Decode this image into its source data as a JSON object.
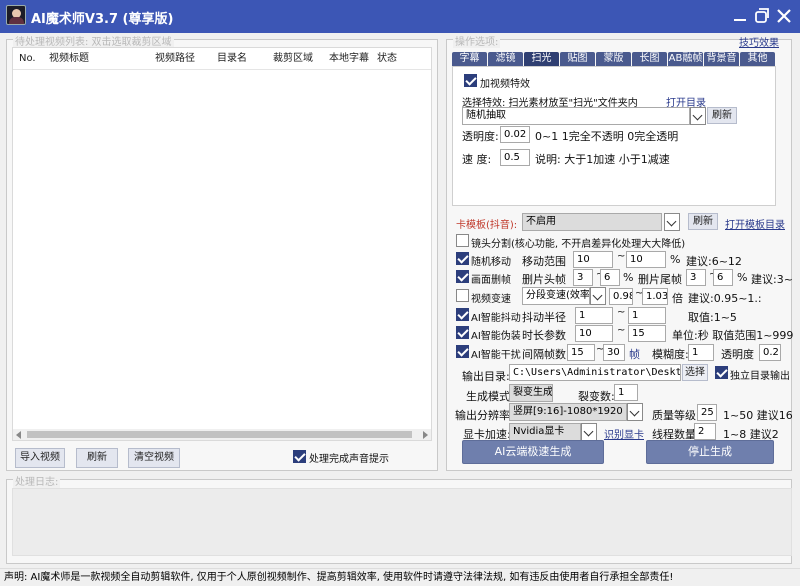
{
  "app": {
    "title": "AI魔术师V3.7 (尊享版)"
  },
  "left_panel": {
    "legend": "待处理视频列表: 双击选取裁剪区域",
    "columns": [
      "No.",
      "视频标题",
      "视频路径",
      "目录名",
      "裁剪区域",
      "本地字幕",
      "状态"
    ],
    "buttons": {
      "import": "导入视频",
      "refresh": "刷新",
      "clear": "清空视频"
    },
    "sound_prompt": {
      "label": "处理完成声音提示",
      "checked": true
    }
  },
  "options": {
    "legend": "操作选项:",
    "tutorial_link": "技巧效果",
    "tabs": [
      "字幕",
      "滤镜",
      "扫光",
      "贴图",
      "蒙版",
      "长图",
      "AB融帧",
      "背景音",
      "其他"
    ],
    "active_tab": "扫光",
    "scan": {
      "add_effect": {
        "label": "加视频特效",
        "checked": true
      },
      "hint": "选择特效: 扫光素材放至\"扫光\"文件夹内",
      "open_dir": "打开目录",
      "effect_select": "随机抽取",
      "refresh": "刷新",
      "opacity_label": "透明度:",
      "opacity_value": "0.02",
      "opacity_note": "0~1   1完全不透明 0完全透明",
      "speed_label": "速   度:",
      "speed_value": "0.5",
      "speed_note": "说明: 大于1加速 小于1减速"
    },
    "card_template": {
      "label": "卡模板(抖音):",
      "value": "不启用",
      "refresh": "刷新",
      "open_dir": "打开模板目录"
    },
    "scene_split": {
      "label": "镜头分割(核心功能, 不开启差异化处理大大降低)",
      "checked": false
    },
    "random_move": {
      "label": "随机移动",
      "checked": true,
      "range_label": "移动范围",
      "min": "10",
      "max": "10",
      "unit": "%",
      "suggest": "建议:6~12"
    },
    "frame_cut": {
      "label": "画面删帧",
      "checked": true,
      "head_label": "删片头帧",
      "head_min": "3",
      "head_max": "6",
      "unit": "%",
      "tail_label": "删片尾帧",
      "tail_min": "3",
      "tail_max": "6",
      "tail_unit": "%",
      "suggest": "建议:3~"
    },
    "speed_change": {
      "label": "视频变速",
      "checked": false,
      "mode": "分段变速(效率",
      "min": "0.98",
      "max": "1.03",
      "unit": "倍",
      "suggest": "建议:0.95~1.:"
    },
    "ai_shake": {
      "label": "AI智能抖动",
      "checked": true,
      "radius_label": "抖动半径",
      "min": "1",
      "max": "1",
      "note": "取值:1~5"
    },
    "ai_disguise": {
      "label": "AI智能伪装",
      "checked": true,
      "param_label": "时长参数",
      "min": "10",
      "max": "15",
      "note": "单位:秒 取值范围1~999"
    },
    "ai_interfere": {
      "label": "AI智能干扰",
      "checked": true,
      "interval_label": "间隔帧数",
      "min": "15",
      "max": "30",
      "unit": "帧",
      "blur_label": "模糊度:",
      "blur_value": "1",
      "opacity_label": "透明度",
      "opacity_value": "0.2"
    },
    "output": {
      "label": "输出目录:",
      "path": "C:\\Users\\Administrator\\Desktop",
      "choose": "选择",
      "separate": {
        "label": "独立目录输出",
        "checked": true
      }
    },
    "gen_mode": {
      "label": "生成模式:",
      "value": "裂变生成",
      "count_label": "裂变数:",
      "count": "1"
    },
    "resolution": {
      "label": "输出分辨率:",
      "value": "竖屏[9:16]-1080*1920",
      "quality_label": "质量等级",
      "quality": "25",
      "quality_note": "1~50  建议16"
    },
    "gpu": {
      "label": "显卡加速:",
      "value": "Nvidia显卡",
      "detect": "识别显卡",
      "threads_label": "线程数量:",
      "threads": "2",
      "threads_note": "1~8  建议2"
    },
    "actions": {
      "start": "AI云端极速生成",
      "stop": "停止生成"
    }
  },
  "log": {
    "legend": "处理日志:"
  },
  "status": {
    "text": "声明: AI魔术师是一款视频全自动剪辑软件, 仅用于个人原创视频制作、提高剪辑效率, 使用软件时请遵守法律法规, 如有违反由使用者自行承担全部责任!"
  }
}
